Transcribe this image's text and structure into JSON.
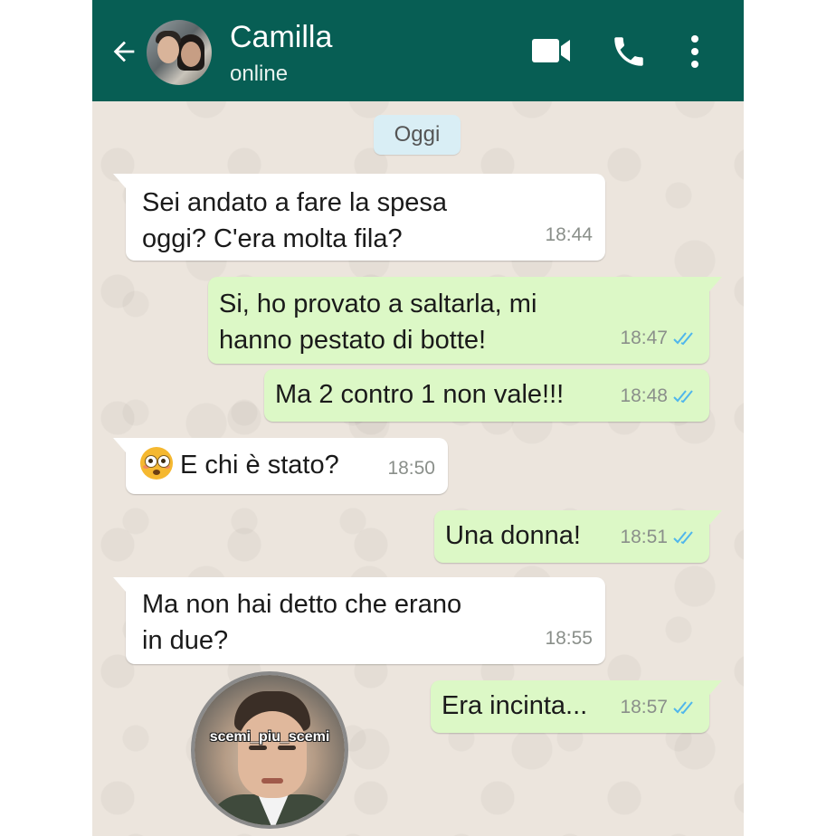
{
  "header": {
    "contact_name": "Camilla",
    "status": "online",
    "icons": [
      "back-arrow-icon",
      "avatar",
      "video-call-icon",
      "phone-icon",
      "more-vert-icon"
    ]
  },
  "date_chip": "Oggi",
  "messages": [
    {
      "dir": "in",
      "lines": [
        "Sei andato a fare la spesa",
        "oggi? C'era molta fila?"
      ],
      "time": "18:44"
    },
    {
      "dir": "out",
      "lines": [
        "Si, ho provato a saltarla, mi",
        "hanno pestato di botte!"
      ],
      "time": "18:47",
      "read": true
    },
    {
      "dir": "out",
      "lines": [
        "Ma 2 contro 1 non vale!!!"
      ],
      "time": "18:48",
      "read": true
    },
    {
      "dir": "in",
      "emoji": "flushed-face-emoji",
      "lines": [
        "E chi è stato?"
      ],
      "time": "18:50"
    },
    {
      "dir": "out",
      "lines": [
        "Una donna!"
      ],
      "time": "18:51",
      "read": true
    },
    {
      "dir": "in",
      "lines": [
        "Ma non hai detto che erano",
        "in due?"
      ],
      "time": "18:55"
    },
    {
      "dir": "out",
      "lines": [
        "Era incinta..."
      ],
      "time": "18:57",
      "read": true
    }
  ],
  "watermark": {
    "label": "scemi_piu_scemi"
  },
  "colors": {
    "header": "#075e54",
    "outgoing": "#dcf8c6",
    "incoming": "#ffffff",
    "read_ticks": "#4fb6ec",
    "background": "#ece5dd"
  }
}
